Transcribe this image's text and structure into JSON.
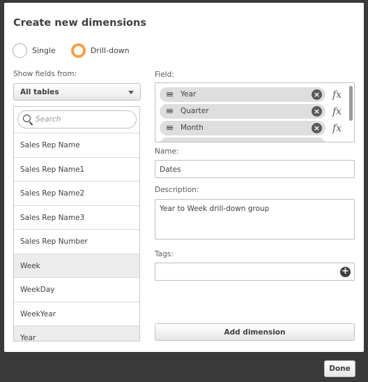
{
  "dialog": {
    "title": "Create new dimensions",
    "mode_options": [
      {
        "label": "Single",
        "selected": false
      },
      {
        "label": "Drill-down",
        "selected": true
      }
    ],
    "accent_color": "#f5a04a"
  },
  "left": {
    "show_fields_label": "Show fields from:",
    "table_select_value": "All tables",
    "search_placeholder": "Search",
    "fields": [
      "Sales Rep Name",
      "Sales Rep Name1",
      "Sales Rep Name2",
      "Sales Rep Name3",
      "Sales Rep Number",
      "Week",
      "WeekDay",
      "WeekYear",
      "Year"
    ],
    "highlighted_fields": [
      "Week",
      "Year"
    ]
  },
  "right": {
    "field_label": "Field:",
    "drill_fields": [
      "Year",
      "Quarter",
      "Month"
    ],
    "fx_label": "fx",
    "name_label": "Name:",
    "name_value": "Dates",
    "description_label": "Description:",
    "description_value": "Year to Week drill-down group",
    "tags_label": "Tags:",
    "add_button": "Add dimension"
  },
  "footer": {
    "done_button": "Done"
  },
  "icons": {
    "search": "search-icon",
    "dropdown": "chevron-down-icon",
    "remove": "close-circle-icon",
    "drag": "drag-handle-icon",
    "add_tag": "plus-circle-icon",
    "expression": "fx-icon"
  }
}
